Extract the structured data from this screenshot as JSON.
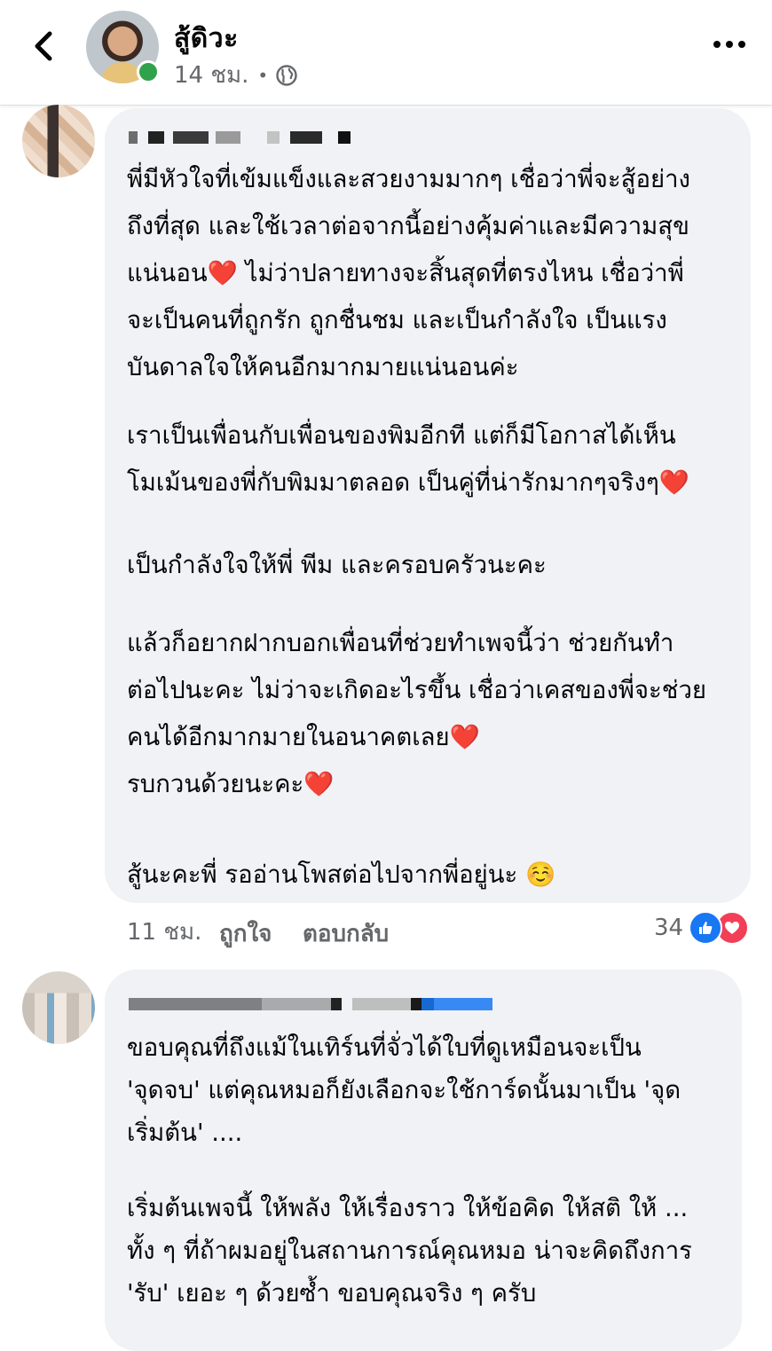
{
  "header": {
    "author_name": "สู้ดิวะ",
    "post_time": "14 ชม.",
    "separator": "•",
    "back_icon": "chevron-left-icon",
    "privacy_icon": "globe-icon",
    "more_icon": "more-horizontal-icon",
    "online_color": "#31a24c"
  },
  "comments": [
    {
      "paragraphs": [
        "พี่มีหัวใจที่เข้มแข็งและสวยงามมากๆ  เชื่อว่าพี่จะสู้อย่าง\nถึงที่สุด และใช้เวลาต่อจากนี้อย่างคุ้มค่าและมีความสุข\nแน่นอน❤️ ไม่ว่าปลายทางจะสิ้นสุดที่ตรงไหน เชื่อว่าพี่\nจะเป็นคนที่ถูกรัก ถูกชื่นชม และเป็นกำลังใจ เป็นแรง\nบันดาลใจให้คนอีกมากมายแน่นอนค่ะ",
        "เราเป็นเพื่อนกับเพื่อนของพิมอีกที แต่ก็มีโอกาสได้เห็น\nโมเม้นของพี่กับพิมมาตลอด เป็นคู่ที่น่ารักมากๆจริงๆ❤️",
        "เป็นกำลังใจให้พี่ พีม และครอบครัวนะคะ",
        "แล้วก็อยากฝากบอกเพื่อนที่ช่วยทำเพจนี้ว่า ช่วยกันทำ\nต่อไปนะคะ ไม่ว่าจะเกิดอะไรขึ้น เชื่อว่าเคสของพี่จะช่วย\nคนได้อีกมากมายในอนาคตเลย❤️\nรบกวนด้วยนะคะ❤️",
        "สู้นะคะพี่ รออ่านโพสต่อไปจากพี่อยู่นะ ☺️"
      ],
      "time": "11 ชม.",
      "like_label": "ถูกใจ",
      "reply_label": "ตอบกลับ",
      "reaction_count": "34",
      "reaction_icons": [
        "like-icon",
        "love-icon"
      ]
    },
    {
      "paragraphs": [
        "ขอบคุณที่ถึงแม้ในเทิร์นที่จั่วได้ใบที่ดูเหมือนจะเป็น\n'จุดจบ' แต่คุณหมอก็ยังเลือกจะใช้การ์ดนั้นมาเป็น 'จุด\nเริ่มต้น' ....",
        "เริ่มต้นเพจนี้ ให้พลัง ให้เรื่องราว ให้ข้อคิด ให้สติ ให้ ...\nทั้ง ๆ ที่ถ้าผมอยู่ในสถานการณ์คุณหมอ น่าจะคิดถึงการ\n'รับ' เยอะ ๆ ด้วยซ้ำ ขอบคุณจริง ๆ ครับ"
      ]
    }
  ],
  "colors": {
    "bubble": "#f0f2f5",
    "secondary_text": "#65676b",
    "like_blue": "#1877f2",
    "love_red": "#f33e58"
  }
}
